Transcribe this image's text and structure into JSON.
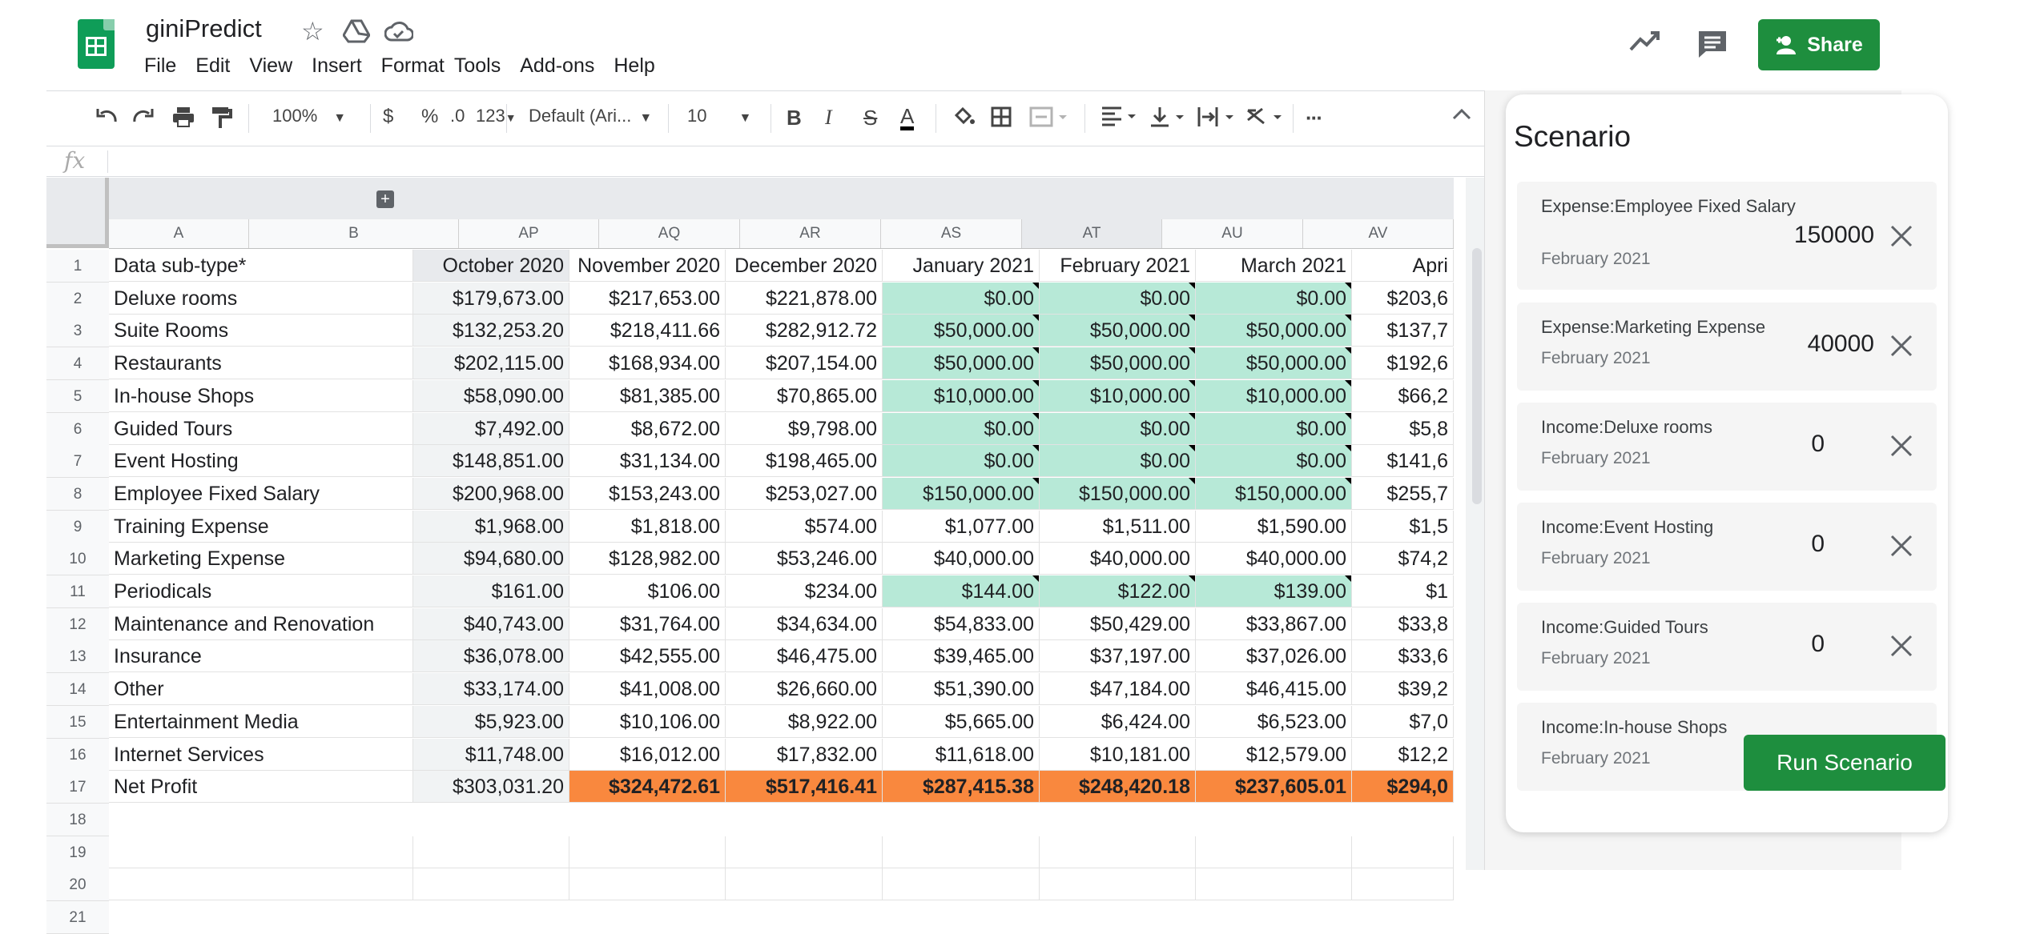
{
  "header": {
    "title": "giniPredict",
    "menu": [
      "File",
      "Edit",
      "View",
      "Insert",
      "Format",
      "Tools",
      "Add-ons",
      "Help"
    ],
    "share_label": "Share"
  },
  "toolbar": {
    "zoom": "100%",
    "currency": "$",
    "percent": "%",
    "decimals": ".0",
    "more_formats": "123",
    "font": "Default (Ari...",
    "font_size": "10",
    "bold": "B",
    "italic": "I",
    "strike": "S",
    "text_color": "A",
    "more": "···"
  },
  "formula_bar": {
    "fx": "fx",
    "value": ""
  },
  "sheet": {
    "columns": [
      "A",
      "B",
      "AP",
      "AQ",
      "AR",
      "AS",
      "AT",
      "AU",
      "AV"
    ],
    "row_numbers": [
      "1",
      "2",
      "3",
      "4",
      "5",
      "6",
      "7",
      "8",
      "9",
      "10",
      "11",
      "12",
      "13",
      "14",
      "15",
      "16",
      "17",
      "18",
      "19",
      "20",
      "21"
    ],
    "header_row": [
      "Data sub-type*",
      "October 2020",
      "November 2020",
      "December 2020",
      "January 2021",
      "February 2021",
      "March 2021",
      "Apri"
    ],
    "rows": [
      {
        "label": "Deluxe rooms",
        "values": [
          "$179,673.00",
          "$217,653.00",
          "$221,878.00",
          "$0.00",
          "$0.00",
          "$0.00",
          "$203,6"
        ]
      },
      {
        "label": "Suite Rooms",
        "values": [
          "$132,253.20",
          "$218,411.66",
          "$282,912.72",
          "$50,000.00",
          "$50,000.00",
          "$50,000.00",
          "$137,7"
        ]
      },
      {
        "label": "Restaurants",
        "values": [
          "$202,115.00",
          "$168,934.00",
          "$207,154.00",
          "$50,000.00",
          "$50,000.00",
          "$50,000.00",
          "$192,6"
        ]
      },
      {
        "label": "In-house Shops",
        "values": [
          "$58,090.00",
          "$81,385.00",
          "$70,865.00",
          "$10,000.00",
          "$10,000.00",
          "$10,000.00",
          "$66,2"
        ]
      },
      {
        "label": "Guided Tours",
        "values": [
          "$7,492.00",
          "$8,672.00",
          "$9,798.00",
          "$0.00",
          "$0.00",
          "$0.00",
          "$5,8"
        ]
      },
      {
        "label": "Event Hosting",
        "values": [
          "$148,851.00",
          "$31,134.00",
          "$198,465.00",
          "$0.00",
          "$0.00",
          "$0.00",
          "$141,6"
        ]
      },
      {
        "label": "Employee Fixed Salary",
        "values": [
          "$200,968.00",
          "$153,243.00",
          "$253,027.00",
          "$150,000.00",
          "$150,000.00",
          "$150,000.00",
          "$255,7"
        ]
      },
      {
        "label": "Training Expense",
        "values": [
          "$1,968.00",
          "$1,818.00",
          "$574.00",
          "$1,077.00",
          "$1,511.00",
          "$1,590.00",
          "$1,5"
        ]
      },
      {
        "label": "Marketing Expense",
        "values": [
          "$94,680.00",
          "$128,982.00",
          "$53,246.00",
          "$40,000.00",
          "$40,000.00",
          "$40,000.00",
          "$74,2"
        ]
      },
      {
        "label": "Periodicals",
        "values": [
          "$161.00",
          "$106.00",
          "$234.00",
          "$144.00",
          "$122.00",
          "$139.00",
          "$1"
        ]
      },
      {
        "label": "Maintenance and Renovation",
        "values": [
          "$40,743.00",
          "$31,764.00",
          "$34,634.00",
          "$54,833.00",
          "$50,429.00",
          "$33,867.00",
          "$33,8"
        ]
      },
      {
        "label": "Insurance",
        "values": [
          "$36,078.00",
          "$42,555.00",
          "$46,475.00",
          "$39,465.00",
          "$37,197.00",
          "$37,026.00",
          "$33,6"
        ]
      },
      {
        "label": "Other",
        "values": [
          "$33,174.00",
          "$41,008.00",
          "$26,660.00",
          "$51,390.00",
          "$47,184.00",
          "$46,415.00",
          "$39,2"
        ]
      },
      {
        "label": "Entertainment Media",
        "values": [
          "$5,923.00",
          "$10,106.00",
          "$8,922.00",
          "$5,665.00",
          "$6,424.00",
          "$6,523.00",
          "$7,0"
        ]
      },
      {
        "label": "Internet Services",
        "values": [
          "$11,748.00",
          "$16,012.00",
          "$17,832.00",
          "$11,618.00",
          "$10,181.00",
          "$12,579.00",
          "$12,2"
        ]
      },
      {
        "label": "Net Profit",
        "values": [
          "$303,031.20",
          "$324,472.61",
          "$517,416.41",
          "$287,415.38",
          "$248,420.18",
          "$237,605.01",
          "$294,0"
        ]
      }
    ],
    "teal_rows": [
      2,
      3,
      4,
      5,
      6,
      7,
      8,
      11
    ],
    "colors": {
      "teal": "#b7e9d7",
      "orange": "#f9883e",
      "green": "#1e8e3e"
    }
  },
  "scenario": {
    "title": "Scenario",
    "items": [
      {
        "label": "Expense:Employee Fixed Salary",
        "date": "February 2021",
        "value": "150000"
      },
      {
        "label": "Expense:Marketing Expense",
        "date": "February 2021",
        "value": "40000"
      },
      {
        "label": "Income:Deluxe rooms",
        "date": "February 2021",
        "value": "0"
      },
      {
        "label": "Income:Event Hosting",
        "date": "February 2021",
        "value": "0"
      },
      {
        "label": "Income:Guided Tours",
        "date": "February 2021",
        "value": "0"
      },
      {
        "label": "Income:In-house Shops",
        "date": "February 2021",
        "value": ""
      }
    ],
    "run_label": "Run Scenario"
  }
}
